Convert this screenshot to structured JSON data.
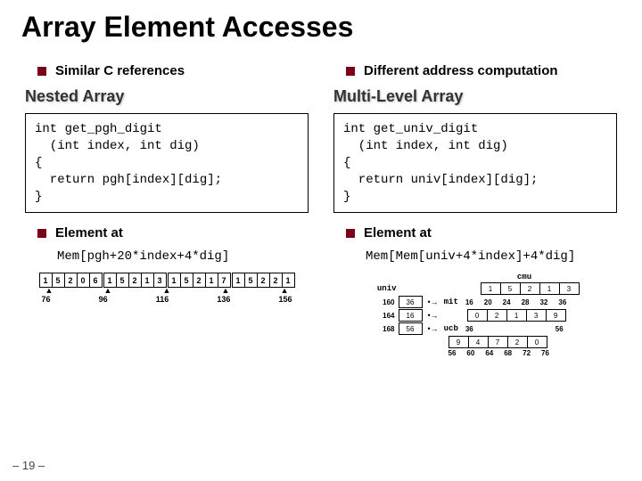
{
  "title": "Array Element Accesses",
  "left": {
    "bullet1": "Similar C references",
    "subhead": "Nested Array",
    "code": "int get_pgh_digit\n  (int index, int dig)\n{\n  return pgh[index][dig];\n}",
    "bullet2": "Element at",
    "memexpr": "Mem[pgh+20*index+4*dig]"
  },
  "right": {
    "bullet1": "Different address computation",
    "subhead": "Multi-Level Array",
    "code": "int get_univ_digit\n  (int index, int dig)\n{\n  return univ[index][dig];\n}",
    "bullet2": "Element at",
    "memexpr": "Mem[Mem[univ+4*index]+4*dig]"
  },
  "figLeft": {
    "cells": [
      "1",
      "5",
      "2",
      "0",
      "6",
      "1",
      "5",
      "2",
      "1",
      "3",
      "1",
      "5",
      "2",
      "1",
      "7",
      "1",
      "5",
      "2",
      "2",
      "1"
    ],
    "ticks": [
      "76",
      "96",
      "116",
      "136",
      "156"
    ]
  },
  "figRight": {
    "top": {
      "cmu": "cmu",
      "mit": "mit",
      "ucb": "ucb",
      "univ": "univ"
    },
    "ptrAddrs": [
      "160",
      "164",
      "168"
    ],
    "ptrVals": [
      "36",
      "16",
      "56"
    ],
    "rows": [
      {
        "vals": [
          "1",
          "5",
          "2",
          "1",
          "3"
        ],
        "addrs": [
          "16",
          "20",
          "24",
          "28",
          "32",
          "36"
        ]
      },
      {
        "vals": [
          "0",
          "2",
          "1",
          "3",
          "9"
        ],
        "addrs": [
          "36",
          "56"
        ]
      },
      {
        "vals": [
          "9",
          "4",
          "7",
          "2",
          "0"
        ],
        "addrs": [
          "56",
          "60",
          "64",
          "68",
          "72",
          "76"
        ]
      }
    ]
  },
  "pagenum": "– 19 –"
}
